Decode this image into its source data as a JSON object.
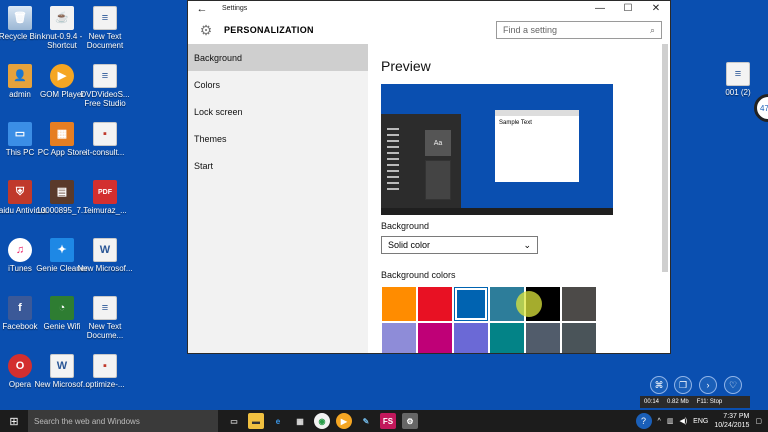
{
  "desktop": {
    "icons": [
      {
        "label": "Recycle Bin"
      },
      {
        "label": "knut-0.9.4 - Shortcut"
      },
      {
        "label": "New Text Document"
      },
      {
        "label": "admin"
      },
      {
        "label": "GOM Player"
      },
      {
        "label": "DVDVideoS... Free Studio"
      },
      {
        "label": "This PC"
      },
      {
        "label": "PC App Store"
      },
      {
        "label": "it-consult..."
      },
      {
        "label": "Baidu Antivirus"
      },
      {
        "label": "10000895_7..."
      },
      {
        "label": "Teimuraz_..."
      },
      {
        "label": "iTunes"
      },
      {
        "label": "Genie Cleaner"
      },
      {
        "label": "New Microsof..."
      },
      {
        "label": "Facebook"
      },
      {
        "label": "Genie Wifi"
      },
      {
        "label": "New Text Docume..."
      },
      {
        "label": "Opera"
      },
      {
        "label": "New Microsof..."
      },
      {
        "label": "optimize-..."
      },
      {
        "label": "001 (2)"
      }
    ]
  },
  "window": {
    "title": "Settings",
    "header_title": "PERSONALIZATION",
    "search_placeholder": "Find a setting",
    "nav": [
      {
        "label": "Background",
        "active": true
      },
      {
        "label": "Colors"
      },
      {
        "label": "Lock screen"
      },
      {
        "label": "Themes"
      },
      {
        "label": "Start"
      }
    ],
    "content": {
      "preview_heading": "Preview",
      "preview_sample_text": "Sample Text",
      "preview_tile_text": "Aa",
      "background_label": "Background",
      "background_value": "Solid color",
      "colors_label": "Background colors",
      "swatches": [
        "#ff8c00",
        "#e81123",
        "#0063b1",
        "#2d7d9a",
        "#000000",
        "#4c4a48",
        "#8e8cd8",
        "#bf0077",
        "#6b69d6",
        "#038387",
        "#515c6b",
        "#4a5459"
      ],
      "selected_swatch": 2
    }
  },
  "taskbar": {
    "search_placeholder": "Search the web and Windows",
    "lang": "ENG",
    "time": "7:37 PM",
    "date": "10/24/2015"
  },
  "recorder": {
    "elapsed": "00:14",
    "size": "0.82 Mb",
    "stop_hint": "F11: Stop"
  },
  "edge_badge": "47"
}
